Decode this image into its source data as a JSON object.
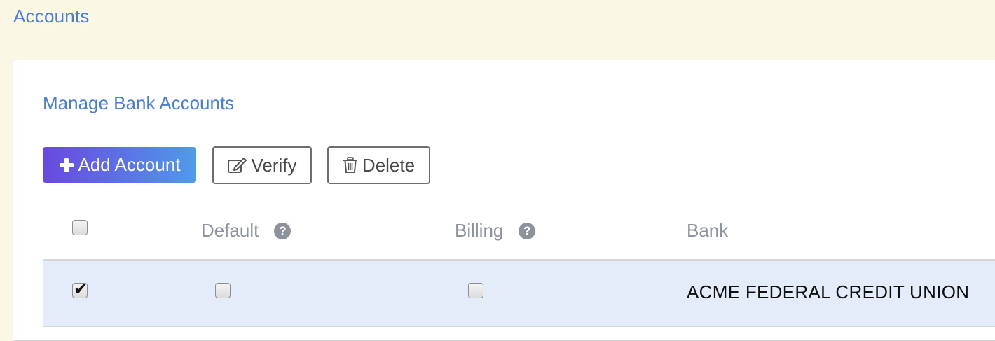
{
  "header": {
    "title": "Accounts"
  },
  "panel": {
    "title": "Manage Bank Accounts",
    "toolbar": {
      "add_label": "Add Account",
      "verify_label": "Verify",
      "delete_label": "Delete"
    },
    "table": {
      "columns": [
        {
          "label": "",
          "type": "select-all"
        },
        {
          "label": "Default",
          "help": true
        },
        {
          "label": "Billing",
          "help": true
        },
        {
          "label": "Bank"
        }
      ],
      "help_glyph": "?",
      "rows": [
        {
          "selected": true,
          "selected_glyph": "✔",
          "default": false,
          "billing": false,
          "bank": "ACME FEDERAL CREDIT UNION"
        }
      ]
    }
  },
  "colors": {
    "page_bg": "#faf8e4",
    "title": "#4a7fd6",
    "row_selected": "#e3ecf8"
  },
  "icons": {
    "add": "plus-icon",
    "verify": "edit-icon",
    "delete": "trash-icon",
    "help": "question-circle-icon"
  }
}
